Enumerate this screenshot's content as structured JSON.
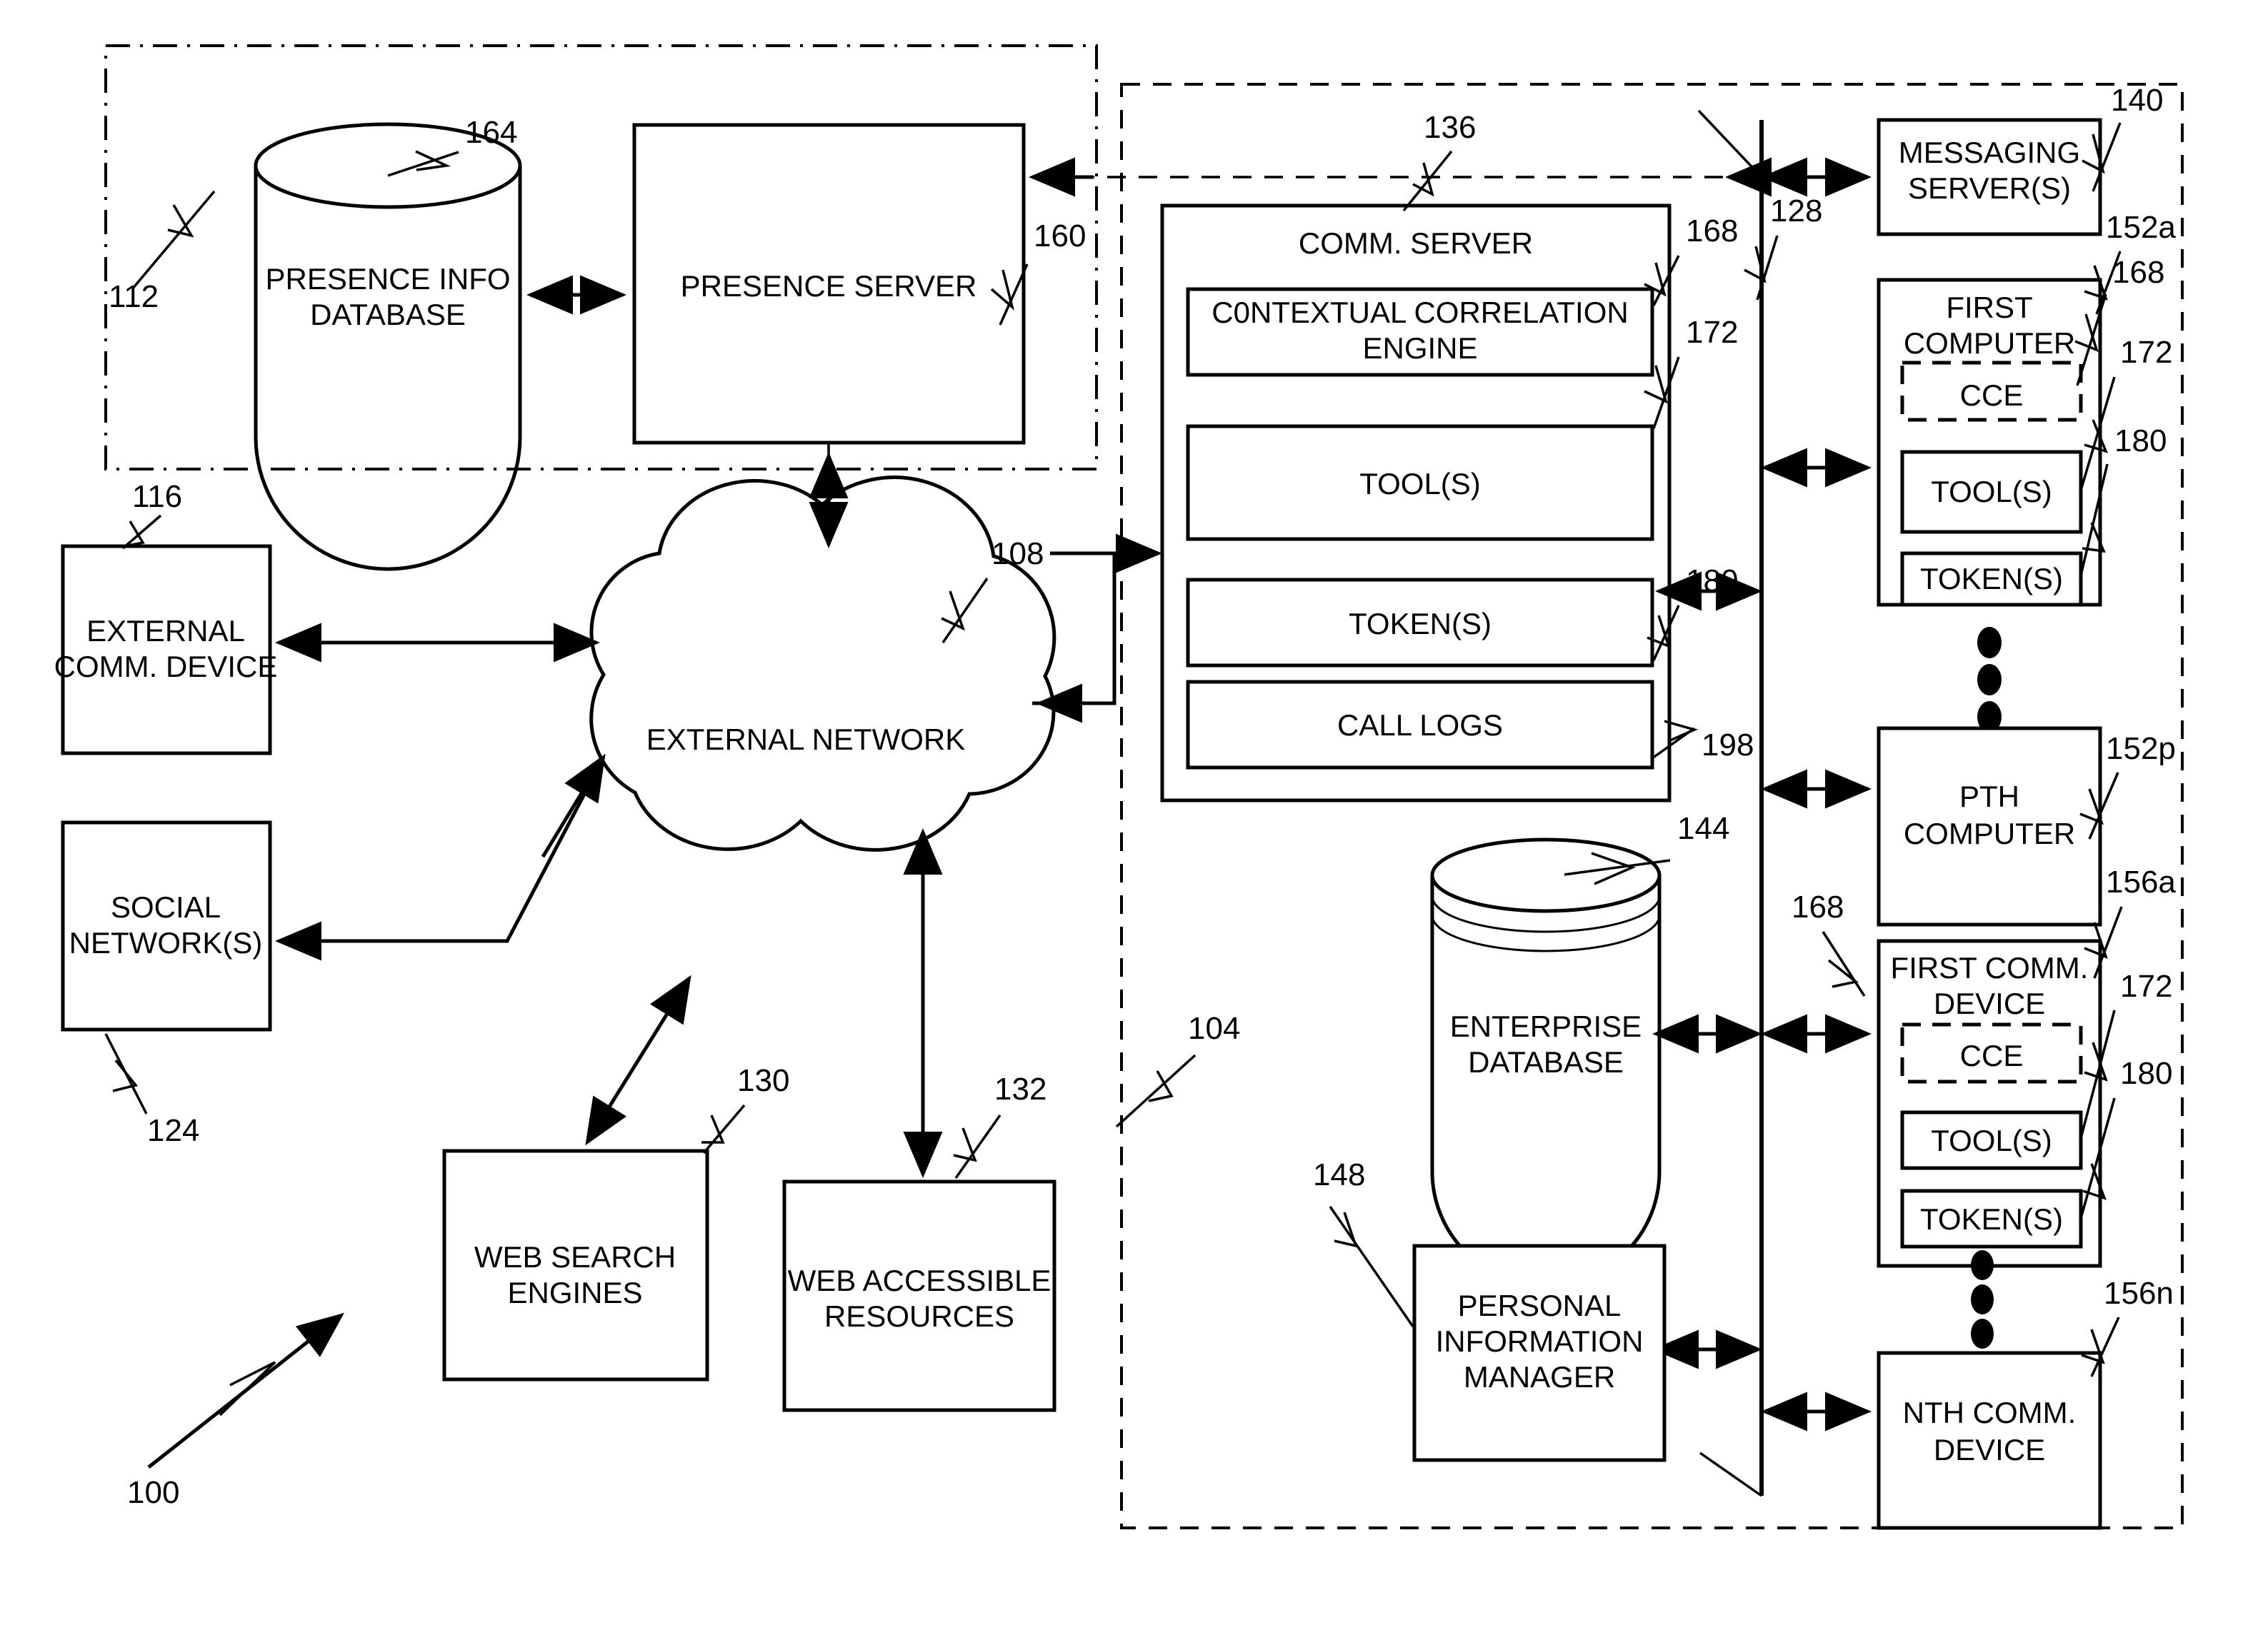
{
  "figure": {
    "type": "patent-block-diagram",
    "figure_ref": "100"
  },
  "panels": {
    "presence_panel_ref": "112",
    "enterprise_panel_ref": "104"
  },
  "blocks": {
    "presence_info_database": {
      "label_line1": "PRESENCE INFO",
      "label_line2": "DATABASE",
      "ref": "164"
    },
    "presence_server": {
      "label": "PRESENCE SERVER",
      "ref": "160"
    },
    "external_comm_device": {
      "label_line1": "EXTERNAL",
      "label_line2": "COMM. DEVICE",
      "ref": "116"
    },
    "social_networks": {
      "label_line1": "SOCIAL",
      "label_line2": "NETWORK(S)",
      "ref": "124"
    },
    "external_network": {
      "label": "EXTERNAL NETWORK",
      "ref": "108"
    },
    "web_search_engines": {
      "label_line1": "WEB SEARCH",
      "label_line2": "ENGINES",
      "ref": "130"
    },
    "web_accessible_resources": {
      "label_line1": "WEB ACCESSIBLE",
      "label_line2": "RESOURCES",
      "ref": "132"
    },
    "comm_server": {
      "label": "COMM. SERVER",
      "ref": "136",
      "children": [
        {
          "label_line1": "C0NTEXTUAL CORRELATION",
          "label_line2": "ENGINE",
          "ref": "168"
        },
        {
          "label": "TOOL(S)",
          "ref": "172"
        },
        {
          "label": "TOKEN(S)",
          "ref": "180"
        },
        {
          "label": "CALL LOGS",
          "ref": "198"
        }
      ]
    },
    "messaging_servers": {
      "label_line1": "MESSAGING",
      "label_line2": "SERVER(S)",
      "ref": "140"
    },
    "internal_bus": {
      "ref": "128"
    },
    "first_computer": {
      "label_line1": "FIRST",
      "label_line2": "COMPUTER",
      "ref": "152a",
      "children": [
        {
          "label": "CCE",
          "ref": "168"
        },
        {
          "label": "TOOL(S)",
          "ref": "172"
        },
        {
          "label": "TOKEN(S)",
          "ref": "180"
        }
      ]
    },
    "pth_computer": {
      "label_line1": "PTH",
      "label_line2": "COMPUTER",
      "ref": "152p"
    },
    "enterprise_database": {
      "label_line1": "ENTERPRISE",
      "label_line2": "DATABASE",
      "ref": "144"
    },
    "personal_information_manager": {
      "label_line1": "PERSONAL",
      "label_line2": "INFORMATION",
      "label_line3": "MANAGER",
      "ref": "148"
    },
    "first_comm_device": {
      "label_line1": "FIRST COMM.",
      "label_line2": "DEVICE",
      "ref": "156a",
      "children": [
        {
          "label": "CCE",
          "ref": "168"
        },
        {
          "label": "TOOL(S)",
          "ref": "172"
        },
        {
          "label": "TOKEN(S)",
          "ref": "180"
        }
      ]
    },
    "nth_comm_device": {
      "label_line1": "NTH COMM.",
      "label_line2": "DEVICE",
      "ref": "156n"
    }
  },
  "bus_refs": {
    "to_first_computer": "168",
    "enterprise_db_side": "168",
    "first_comm_device_side": "168"
  }
}
